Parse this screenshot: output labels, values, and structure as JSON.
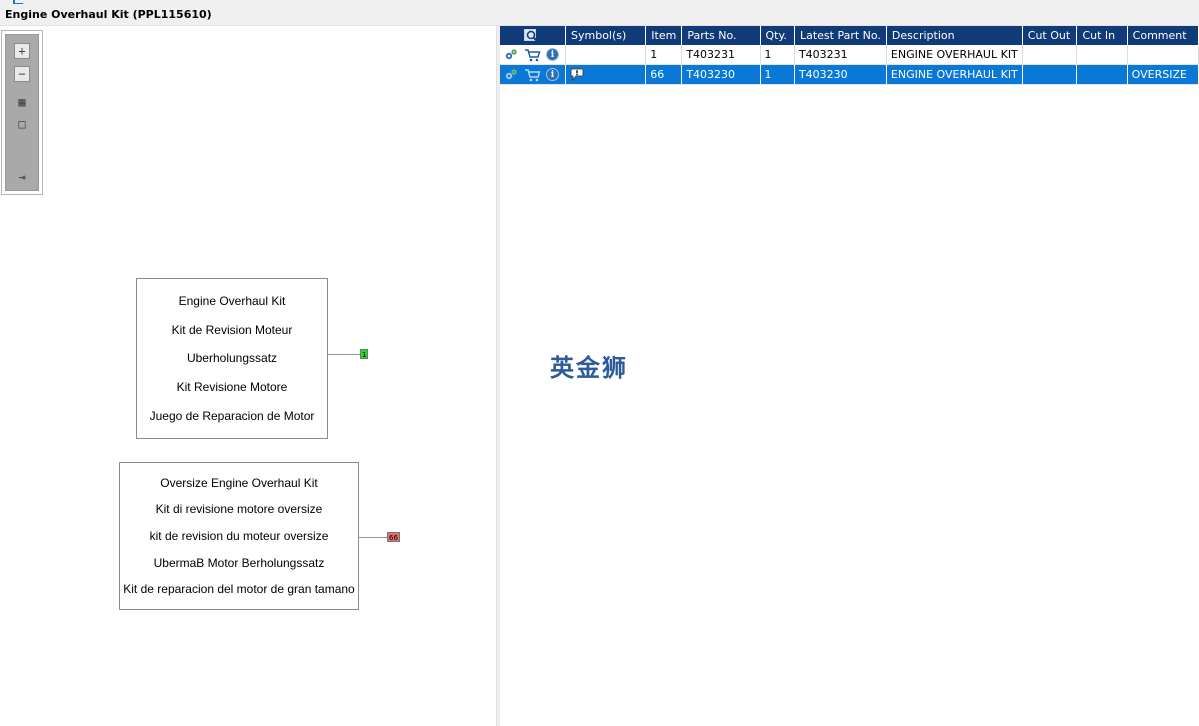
{
  "window": {
    "title": "Engine Overhaul Kit (PPL115610)"
  },
  "toolbar": {
    "zoom_in": "+",
    "zoom_out": "−",
    "fit_all": "▦",
    "actual_size": "□",
    "export": "⇥"
  },
  "diagram": {
    "parts": [
      {
        "lines": [
          "Engine Overhaul Kit",
          "Kit de Revision Moteur",
          "Uberholungssatz",
          "Kit Revisione Motore",
          "Juego de Reparacion de Motor"
        ],
        "tag": "1",
        "tag_color": "#22dd22"
      },
      {
        "lines": [
          "Oversize Engine Overhaul Kit",
          "Kit di revisione motore oversize",
          "kit de revision du moteur oversize",
          "UbermaB Motor Berholungssatz",
          "Kit de reparacion del motor de gran tamano"
        ],
        "tag": "66",
        "tag_color": "#e86d6d"
      }
    ]
  },
  "table": {
    "columns": [
      "Symbol(s)",
      "Item",
      "Parts No.",
      "Qty.",
      "Latest Part No.",
      "Description",
      "Cut Out",
      "Cut In",
      "Comment"
    ],
    "rows": [
      {
        "item": "1",
        "parts_no": "T403231",
        "qty": "1",
        "latest_part_no": "T403231",
        "description": "ENGINE OVERHAUL KIT",
        "cut_out": "",
        "cut_in": "",
        "comment": ""
      },
      {
        "item": "66",
        "parts_no": "T403230",
        "qty": "1",
        "latest_part_no": "T403230",
        "description": "ENGINE OVERHAUL KIT",
        "cut_out": "",
        "cut_in": "",
        "comment": "OVERSIZE"
      }
    ]
  },
  "watermark": "英金狮",
  "colors": {
    "header_bg": "#103a78",
    "selected_row": "#0a78d7",
    "watermark": "#2c5b9a"
  }
}
